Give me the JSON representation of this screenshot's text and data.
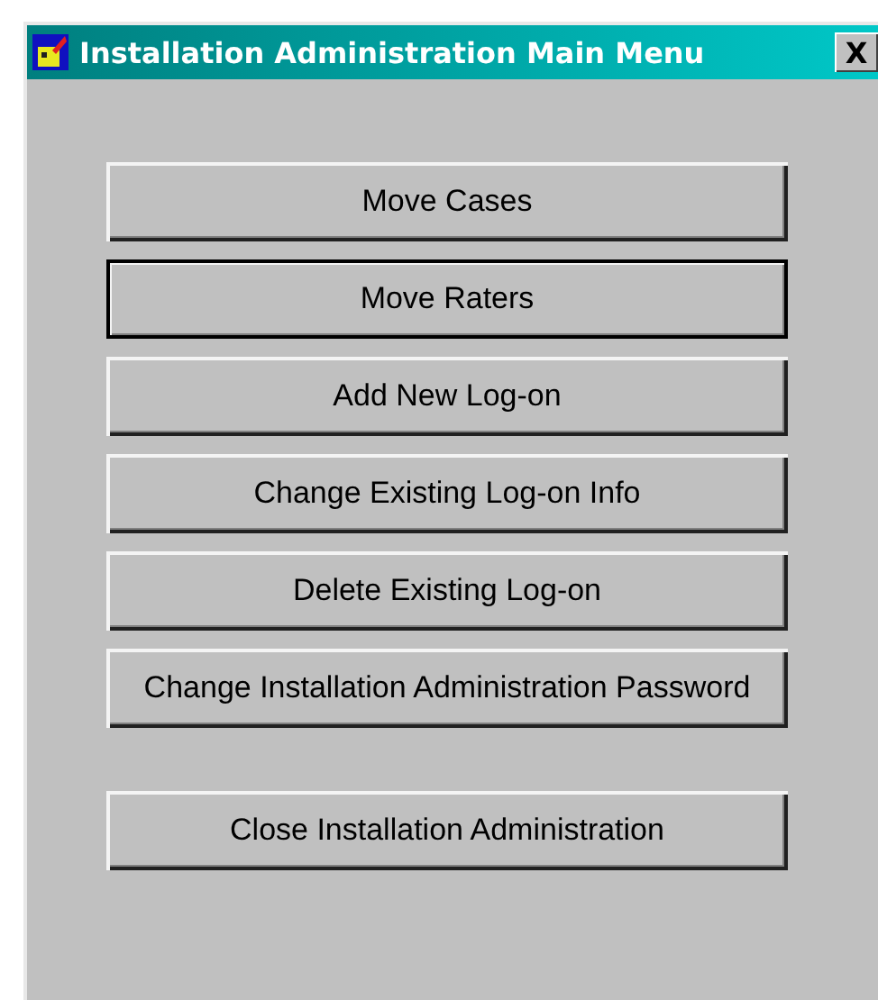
{
  "window": {
    "title": "Installation Administration Main Menu",
    "close_label": "X"
  },
  "buttons": [
    {
      "label": "Move Cases",
      "focused": false
    },
    {
      "label": "Move Raters",
      "focused": true
    },
    {
      "label": "Add New Log-on",
      "focused": false
    },
    {
      "label": "Change Existing Log-on Info",
      "focused": false
    },
    {
      "label": "Delete Existing Log-on",
      "focused": false
    },
    {
      "label": "Change Installation Administration Password",
      "focused": false
    }
  ],
  "close_button": {
    "label": "Close Installation Administration",
    "focused": false
  }
}
